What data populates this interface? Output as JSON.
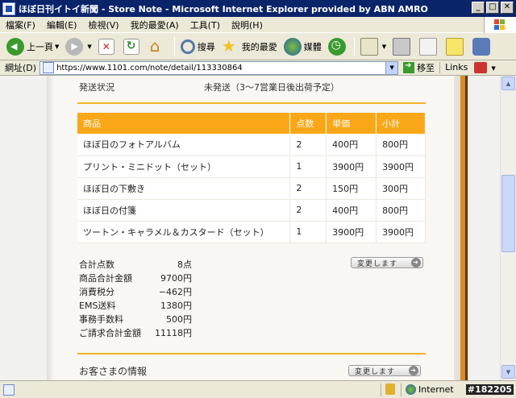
{
  "window": {
    "title": "ほぼ日刊イトイ新聞 - Store Note - Microsoft Internet Explorer provided by ABN AMRO"
  },
  "menu": [
    "檔案(F)",
    "編輯(E)",
    "檢視(V)",
    "我的最愛(A)",
    "工具(T)",
    "說明(H)"
  ],
  "toolbar": {
    "back": "上一頁",
    "search": "搜尋",
    "favorites": "我的最愛",
    "media": "媒體"
  },
  "address": {
    "label": "網址(D)",
    "url": "https://www.1101.com/note/detail/113330864",
    "go": "移至",
    "links": "Links"
  },
  "page": {
    "shipping_label": "発送状況",
    "shipping_value": "未発送（3〜7営業日後出荷予定）",
    "table_headers": [
      "商品",
      "点数",
      "単価",
      "小計"
    ],
    "items": [
      {
        "name": "ほぼ日のフォトアルバム",
        "qty": "2",
        "price": "400円",
        "subtotal": "800円"
      },
      {
        "name": "プリント・ミニドット（セット）",
        "qty": "1",
        "price": "3900円",
        "subtotal": "3900円"
      },
      {
        "name": "ほぼ日の下敷き",
        "qty": "2",
        "price": "150円",
        "subtotal": "300円"
      },
      {
        "name": "ほぼ日の付箋",
        "qty": "2",
        "price": "400円",
        "subtotal": "800円"
      },
      {
        "name": "ツートン・キャラメル＆カスタード（セット）",
        "qty": "1",
        "price": "3900円",
        "subtotal": "3900円"
      }
    ],
    "totals": [
      {
        "label": "合計点数",
        "value": "8点"
      },
      {
        "label": "商品合計金額",
        "value": "9700円"
      },
      {
        "label": "消費税分",
        "value": "−462円"
      },
      {
        "label": "EMS送料",
        "value": "1380円"
      },
      {
        "label": "事務手数料",
        "value": "500円"
      },
      {
        "label": "ご請求合計金額",
        "value": "11118円"
      }
    ],
    "change_button": "変更します",
    "customer_section": "お客さまの情報"
  },
  "status": {
    "zone": "Internet",
    "image_id": "#182205"
  }
}
